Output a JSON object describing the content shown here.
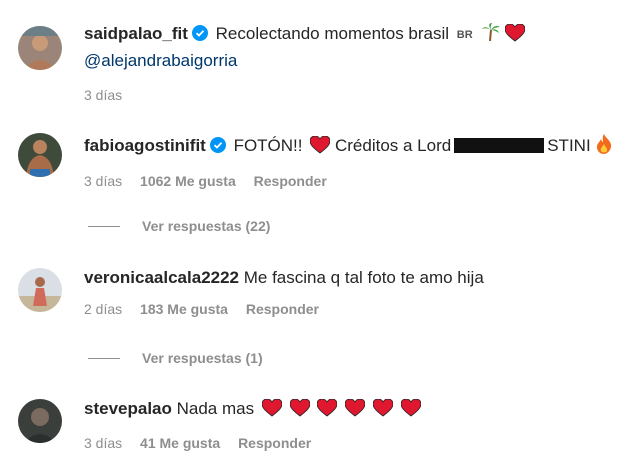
{
  "comments": [
    {
      "username": "saidpalao_fit",
      "verified": true,
      "text": "Recolectando momentos brasil",
      "flag": "BR",
      "mention": "@alejandrabaigorria",
      "time": "3 días"
    },
    {
      "username": "fabioagostinifit",
      "verified": true,
      "text_before": "FOTÓN!!",
      "text_after": "Créditos a Lord",
      "text_end": "STINI",
      "time": "3 días",
      "likes": "1062 Me gusta",
      "reply": "Responder",
      "view_replies": "Ver respuestas (22)"
    },
    {
      "username": "veronicaalcala2222",
      "verified": false,
      "text": "Me fascina q tal foto te amo hija",
      "time": "2 días",
      "likes": "183 Me gusta",
      "reply": "Responder",
      "view_replies": "Ver respuestas (1)"
    },
    {
      "username": "stevepalao",
      "verified": false,
      "text": "Nada mas",
      "time": "3 días",
      "likes": "41 Me gusta",
      "reply": "Responder"
    }
  ],
  "colors": {
    "text": "#262626",
    "secondary": "#8e8e8e",
    "verified": "#0095f6",
    "heart": "#ed4956",
    "mention": "#00376b"
  }
}
